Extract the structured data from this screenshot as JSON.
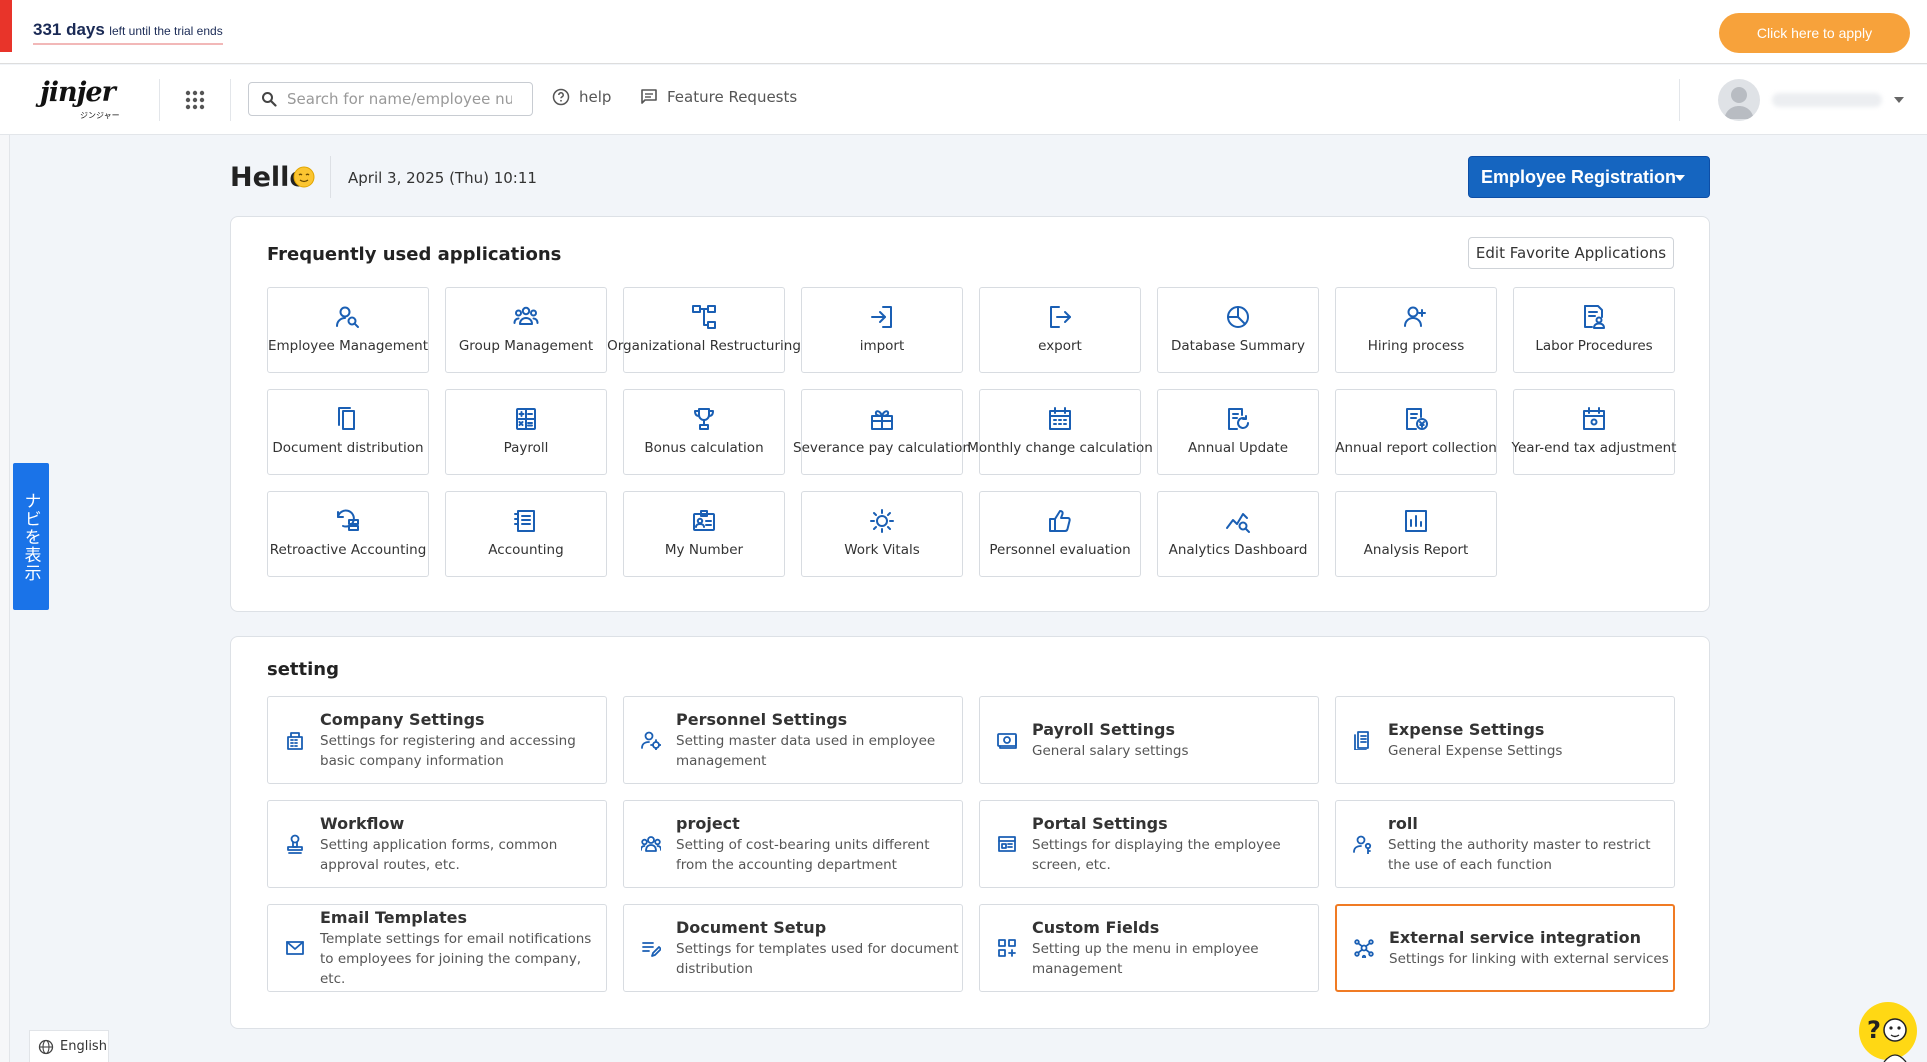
{
  "trial": {
    "days": "331 days",
    "rest": "left until the trial ends",
    "apply_label": "Click here to apply"
  },
  "header": {
    "logo_text": "jinjer",
    "logo_sub": "ジンジャー",
    "search_placeholder": "Search for name/employee nu",
    "help_label": "help",
    "feature_label": "Feature Requests"
  },
  "navi_label": "ナビを表示",
  "greeting": {
    "hello": "Hello",
    "date": "April 3, 2025 (Thu) 10:11",
    "register_label": "Employee Registration"
  },
  "frequent": {
    "title": "Frequently used applications",
    "edit_label": "Edit Favorite Applications",
    "apps": [
      {
        "label": "Employee Management",
        "icon": "user-search-icon"
      },
      {
        "label": "Group Management",
        "icon": "group-icon"
      },
      {
        "label": "Organizational Restructuring",
        "icon": "org-chart-icon"
      },
      {
        "label": "import",
        "icon": "import-icon"
      },
      {
        "label": "export",
        "icon": "export-icon"
      },
      {
        "label": "Database Summary",
        "icon": "pie-chart-icon"
      },
      {
        "label": "Hiring process",
        "icon": "user-add-icon"
      },
      {
        "label": "Labor Procedures",
        "icon": "document-person-icon"
      },
      {
        "label": "Document distribution",
        "icon": "documents-icon"
      },
      {
        "label": "Payroll",
        "icon": "calculator-icon"
      },
      {
        "label": "Bonus calculation",
        "icon": "trophy-icon"
      },
      {
        "label": "Severance pay calculation",
        "icon": "gift-icon"
      },
      {
        "label": "Monthly change calculation",
        "icon": "calendar-grid-icon"
      },
      {
        "label": "Annual Update",
        "icon": "document-refresh-icon"
      },
      {
        "label": "Annual report collection",
        "icon": "document-yen-icon"
      },
      {
        "label": "Year-end tax adjustment",
        "icon": "calendar-check-icon"
      },
      {
        "label": "Retroactive Accounting",
        "icon": "retro-icon"
      },
      {
        "label": "Accounting",
        "icon": "ledger-icon"
      },
      {
        "label": "My Number",
        "icon": "id-badge-icon"
      },
      {
        "label": "Work Vitals",
        "icon": "sun-icon"
      },
      {
        "label": "Personnel evaluation",
        "icon": "thumbs-up-icon"
      },
      {
        "label": "Analytics Dashboard",
        "icon": "trend-search-icon"
      },
      {
        "label": "Analysis Report",
        "icon": "bar-report-icon"
      }
    ]
  },
  "settings": {
    "title": "setting",
    "items": [
      {
        "title": "Company Settings",
        "desc": "Settings for registering and accessing basic company information",
        "icon": "building-icon"
      },
      {
        "title": "Personnel Settings",
        "desc": "Setting master data used in employee management",
        "icon": "user-gear-icon"
      },
      {
        "title": "Payroll Settings",
        "desc": "General salary settings",
        "icon": "money-icon"
      },
      {
        "title": "Expense Settings",
        "desc": "General Expense Settings",
        "icon": "receipt-icon"
      },
      {
        "title": "Workflow",
        "desc": "Setting application forms, common approval routes, etc.",
        "icon": "stamp-icon"
      },
      {
        "title": "project",
        "desc": "Setting of cost-bearing units different from the accounting department",
        "icon": "team-icon"
      },
      {
        "title": "Portal Settings",
        "desc": "Settings for displaying the employee screen, etc.",
        "icon": "portal-icon"
      },
      {
        "title": "roll",
        "desc": "Setting the authority master to restrict the use of each function",
        "icon": "user-key-icon"
      },
      {
        "title": "Email Templates",
        "desc": "Template settings for email notifications to employees for joining the company, etc.",
        "icon": "mail-icon"
      },
      {
        "title": "Document Setup",
        "desc": "Settings for templates used for document distribution",
        "icon": "edit-list-icon"
      },
      {
        "title": "Custom Fields",
        "desc": "Setting up the menu in employee management",
        "icon": "grid-add-icon"
      },
      {
        "title": "External service integration",
        "desc": "Settings for linking with external services",
        "icon": "hub-icon"
      }
    ]
  },
  "footer": {
    "language": "English"
  },
  "colors": {
    "accent": "#1565c0",
    "icon": "#1a5fb4",
    "apply": "#f7a23b",
    "highlight": "#f07b24"
  }
}
